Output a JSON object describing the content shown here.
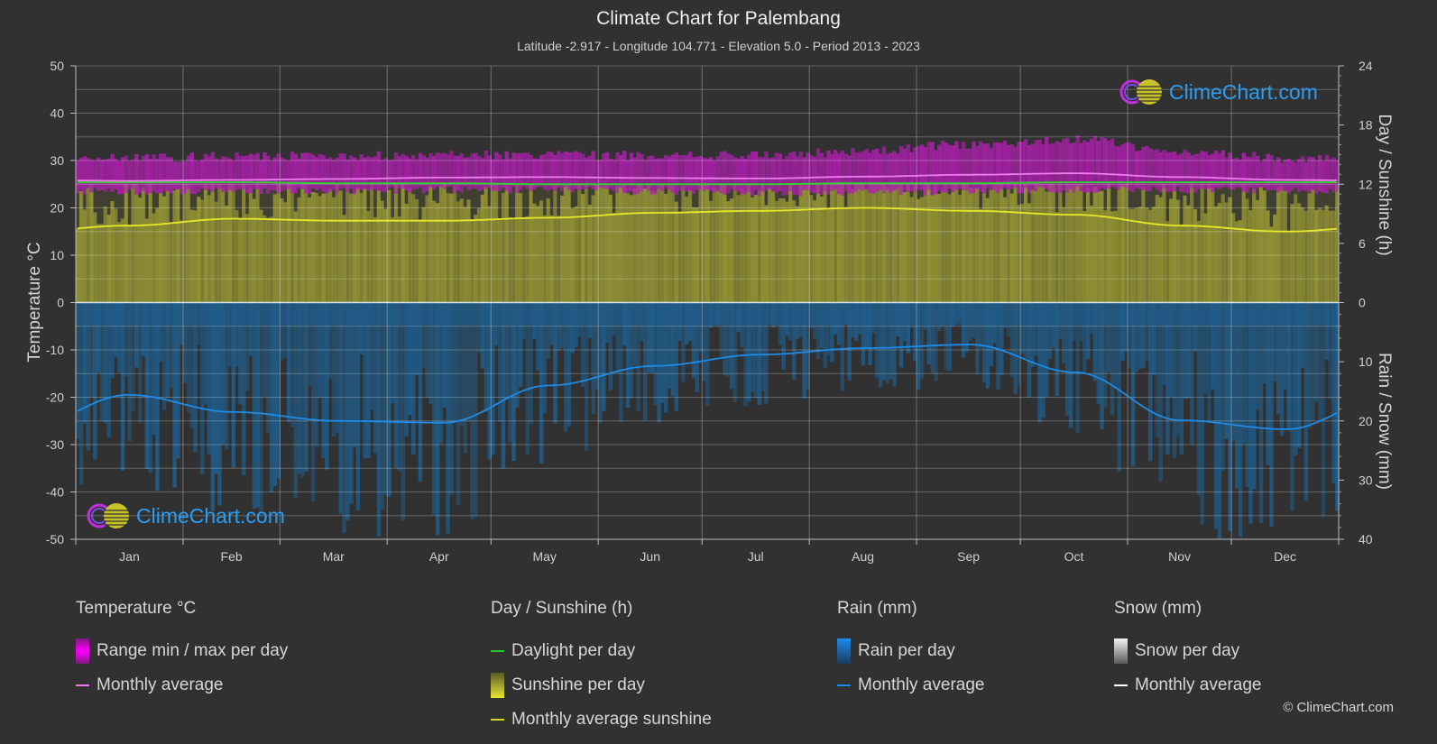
{
  "header": {
    "title": "Climate Chart for Palembang",
    "subtitle": "Latitude -2.917 - Longitude 104.771 - Elevation 5.0 - Period 2013 - 2023"
  },
  "logo_text": "ClimeChart.com",
  "copyright": "© ClimeChart.com",
  "colors": {
    "background": "#313131",
    "temp_range": "#c21fbf",
    "temp_avg": "#f07cf0",
    "daylight": "#33cc33",
    "sunshine": "#8f8f34",
    "sunshine_avg": "#e8e82a",
    "rain": "#1f5f8f",
    "rain_avg": "#1e8ce6",
    "snow_avg": "#ffffff"
  },
  "legend": {
    "temperature": {
      "header": "Temperature °C",
      "items": [
        {
          "label": "Range min / max per day",
          "type": "bar"
        },
        {
          "label": "Monthly average",
          "type": "line"
        }
      ]
    },
    "sunshine": {
      "header": "Day / Sunshine (h)",
      "items": [
        {
          "label": "Daylight per day",
          "type": "line"
        },
        {
          "label": "Sunshine per day",
          "type": "bar"
        },
        {
          "label": "Monthly average sunshine",
          "type": "line"
        }
      ]
    },
    "rain": {
      "header": "Rain (mm)",
      "items": [
        {
          "label": "Rain per day",
          "type": "bar"
        },
        {
          "label": "Monthly average",
          "type": "line"
        }
      ]
    },
    "snow": {
      "header": "Snow (mm)",
      "items": [
        {
          "label": "Snow per day",
          "type": "bar"
        },
        {
          "label": "Monthly average",
          "type": "line"
        }
      ]
    }
  },
  "chart_data": {
    "type": "line",
    "title": "Climate Chart for Palembang",
    "categories": [
      "Jan",
      "Feb",
      "Mar",
      "Apr",
      "May",
      "Jun",
      "Jul",
      "Aug",
      "Sep",
      "Oct",
      "Nov",
      "Dec"
    ],
    "axes": {
      "left": {
        "label": "Temperature °C",
        "range": [
          -50,
          50
        ],
        "ticks": [
          50,
          40,
          30,
          20,
          10,
          0,
          -10,
          -20,
          -30,
          -40,
          -50
        ]
      },
      "right_top": {
        "label": "Day / Sunshine (h)",
        "range": [
          0,
          24
        ],
        "ticks": [
          24,
          18,
          12,
          6,
          0
        ]
      },
      "right_bottom": {
        "label": "Rain / Snow (mm)",
        "range": [
          0,
          40
        ],
        "ticks": [
          0,
          10,
          20,
          30,
          40
        ]
      }
    },
    "grid": true,
    "series": [
      {
        "name": "Temperature monthly average",
        "axis": "left",
        "unit": "°C",
        "values": [
          25.7,
          25.9,
          26.1,
          26.4,
          26.5,
          26.3,
          26.2,
          26.6,
          27.0,
          27.3,
          26.5,
          25.9
        ]
      },
      {
        "name": "Temperature range max (approx)",
        "axis": "left",
        "unit": "°C",
        "values": [
          30.5,
          30.8,
          31.0,
          31.2,
          31.3,
          31.0,
          31.0,
          32.0,
          33.5,
          34.5,
          32.0,
          30.5
        ]
      },
      {
        "name": "Temperature range min (approx)",
        "axis": "left",
        "unit": "°C",
        "values": [
          23.5,
          23.5,
          23.6,
          23.8,
          23.8,
          23.5,
          23.2,
          23.2,
          23.5,
          23.8,
          23.8,
          23.6
        ]
      },
      {
        "name": "Daylight per day",
        "axis": "right_top",
        "unit": "h",
        "values": [
          12.2,
          12.2,
          12.1,
          12.1,
          12.0,
          12.0,
          12.0,
          12.1,
          12.1,
          12.2,
          12.2,
          12.2
        ]
      },
      {
        "name": "Monthly average sunshine",
        "axis": "right_top",
        "unit": "h",
        "values": [
          7.8,
          8.5,
          8.3,
          8.3,
          8.6,
          9.1,
          9.3,
          9.6,
          9.3,
          8.9,
          7.8,
          7.2
        ]
      },
      {
        "name": "Rain monthly average",
        "axis": "right_bottom",
        "unit": "mm",
        "values": [
          15.6,
          18.5,
          20.0,
          20.3,
          14.0,
          10.7,
          8.8,
          7.7,
          7.1,
          11.8,
          19.9,
          21.4
        ]
      },
      {
        "name": "Snow monthly average",
        "axis": "right_bottom",
        "unit": "mm",
        "values": [
          0,
          0,
          0,
          0,
          0,
          0,
          0,
          0,
          0,
          0,
          0,
          0
        ]
      }
    ]
  }
}
